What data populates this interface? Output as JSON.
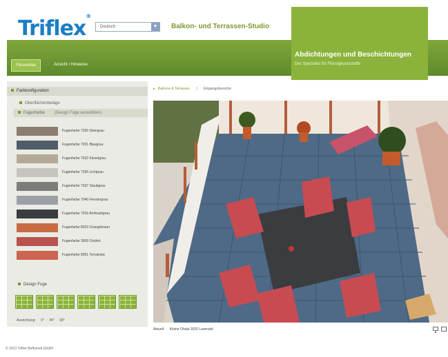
{
  "header": {
    "logo": "Triflex",
    "logo_reg": "®",
    "language_select": "Deutsch",
    "studio_title": "Balkon- und Terrassen-Studio",
    "hero_title": "Abdichtungen und Beschichtungen",
    "hero_subtitle": "Der Spezialist für Flüssigkunststoffe"
  },
  "nav": {
    "tabs": [
      {
        "label": "Fliesenbau"
      },
      {
        "label": "Ansicht / Hinweise"
      }
    ]
  },
  "left_panel": {
    "section_title": "Farbkonfiguration",
    "sub1": "Oberflächenbeläge",
    "sub2": "Fugenfarbe",
    "sub2_hint": "(Design Fuge auswählen)",
    "swatches": [
      {
        "label": "Fugenfarbe 7030 Steingrau",
        "color": "#8d7c71"
      },
      {
        "label": "Fugenfarbe 7031 Blaugrau",
        "color": "#505c68"
      },
      {
        "label": "Fugenfarbe 7032 Kieselgrau",
        "color": "#b3aa98"
      },
      {
        "label": "Fugenfarbe 7035 Lichtgrau",
        "color": "#c5c4be"
      },
      {
        "label": "Fugenfarbe 7037 Staubgrau",
        "color": "#7c7c7a"
      },
      {
        "label": "Fugenfarbe 7040 Fenstergrau",
        "color": "#9ca0a6"
      },
      {
        "label": "Fugenfarbe 7016 Anthrazitgrau",
        "color": "#3a3c3f"
      },
      {
        "label": "Fugenfarbe 8023 Orangebraun",
        "color": "#c76b45"
      },
      {
        "label": "Fugenfarbe 3009 Oxidrot",
        "color": "#b9534e"
      },
      {
        "label": "Fugenfarbe 8001 Terrakotta",
        "color": "#cc6450"
      }
    ],
    "design_title": "Design Fuge",
    "ausrichtung_label": "Ausrichtung:",
    "ausrichtung_0": "0°",
    "ausrichtung_45": "45°",
    "ausrichtung_90": "90°"
  },
  "breadcrumb": {
    "item1": "Balkone & Terrassen",
    "item2": "Eingangsbereiche"
  },
  "scene": {
    "caption_label": "Aktuell:",
    "caption_value": "Kleine Ohala 3020 Lavendel"
  },
  "footer": {
    "copyright": "© 2013 Triflex Beflumeti GmbH"
  },
  "colors": {
    "brand_green": "#8bb33b",
    "logo_blue": "#1a7fc4"
  }
}
